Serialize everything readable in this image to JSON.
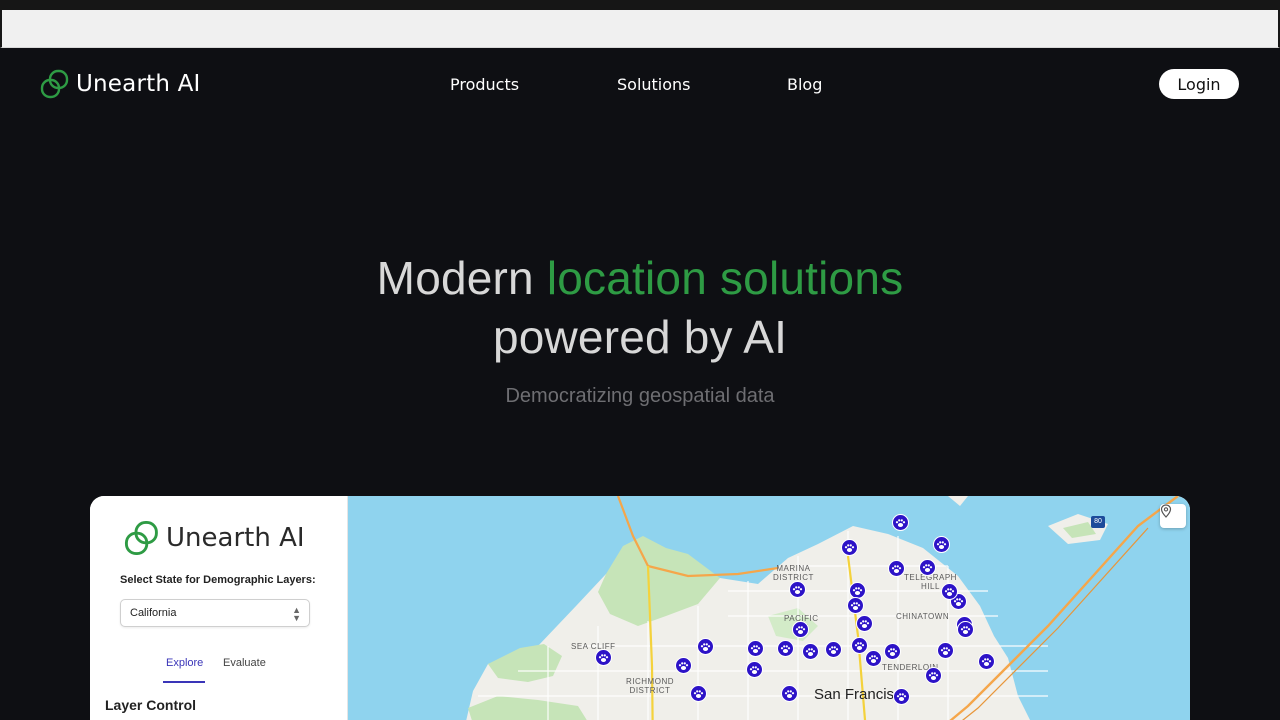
{
  "brand": {
    "name": "Unearth AI",
    "accent_color": "#2e9b44"
  },
  "nav": {
    "links": [
      "Products",
      "Solutions",
      "Blog"
    ],
    "login_label": "Login"
  },
  "hero": {
    "line1_prefix": "Modern ",
    "line1_accent": "location solutions",
    "line2": "powered by AI",
    "subtitle": "Democratizing geospatial data"
  },
  "preview": {
    "panel": {
      "logo_text": "Unearth AI",
      "state_label": "Select State for Demographic Layers:",
      "state_value": "California",
      "tabs": [
        "Explore",
        "Evaluate"
      ],
      "active_tab": "Explore",
      "section_title": "Layer Control"
    },
    "map": {
      "city_label": "San Francis",
      "district_labels": [
        "MARINA\nDISTRICT",
        "PACIFIC\nHEI",
        "SEA CLIFF",
        "RICHMOND\nDISTRICT",
        "CHINATOWN",
        "TELEGRAPH\nHILL",
        "TENDERLOIN"
      ],
      "highway_shield": "80",
      "marker_icon": "paw-icon",
      "location_button_icon": "location-pin-icon",
      "water_color": "#8fd3ee",
      "land_color": "#f0efea",
      "park_color": "#c6e4b8",
      "marker_color": "#2d13c7"
    }
  }
}
